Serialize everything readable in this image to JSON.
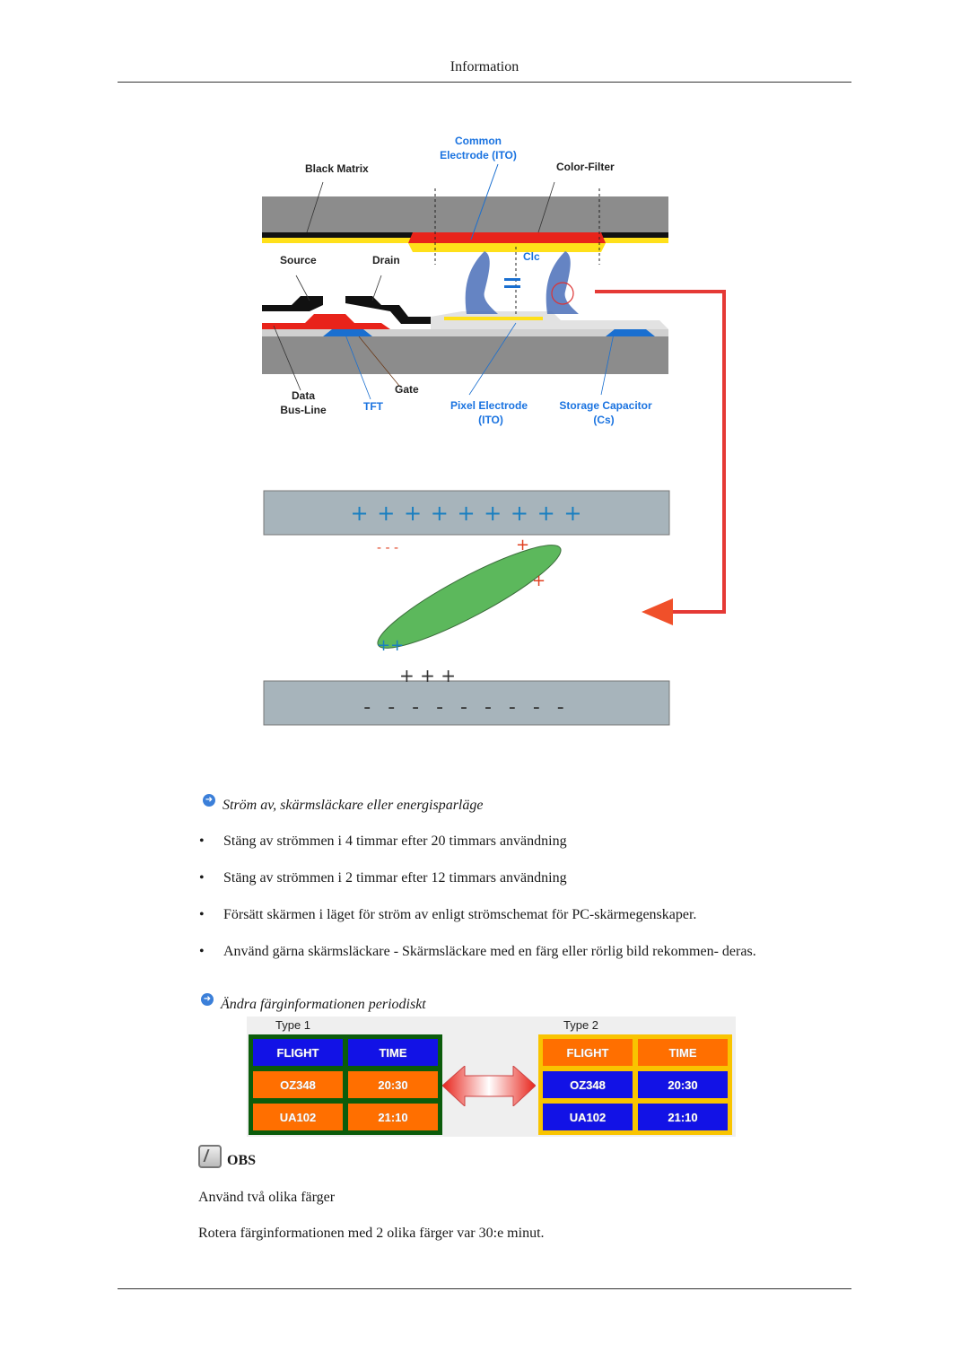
{
  "header": {
    "title": "Information"
  },
  "figure_lcd": {
    "labels": {
      "black_matrix": "Black Matrix",
      "common_electrode": [
        "Common",
        "Electrode (ITO)"
      ],
      "color_filter": "Color-Filter",
      "source": "Source",
      "drain": "Drain",
      "clc": "Clc",
      "data_bus_line": [
        "Data",
        "Bus-Line"
      ],
      "tft": "TFT",
      "gate": "Gate",
      "pixel_electrode": [
        "Pixel Electrode",
        "(ITO)"
      ],
      "storage_capacitor": [
        "Storage Capacitor",
        "(Cs)"
      ]
    },
    "top_plate_charges": "+ + + + + + + + +",
    "bottom_plate_charges": "- - - - - - - - -",
    "colors": {
      "glass": "#8c8c8c",
      "black_matrix": "#111111",
      "color_filter": "#e8231a",
      "ito": "#ffe01a",
      "gate": "#1a6fd0",
      "crystal": "#5cb85c",
      "plate": "#a7b4bb",
      "arrow": "#e53935"
    }
  },
  "section1": {
    "icon": "arrow-right-circle-icon",
    "title": "Ström av, skärmsläckare eller energisparläge",
    "bullets": [
      "Stäng av strömmen i 4 timmar efter 20 timmars användning",
      "Stäng av strömmen i 2 timmar efter 12 timmars användning",
      "Försätt skärmen i läget för ström av enligt strömschemat för PC-skärmegenskaper.",
      "Använd gärna skärmsläckare - Skärmsläckare med en färg eller rörlig bild rekommen- deras."
    ]
  },
  "section2": {
    "icon": "arrow-right-circle-icon",
    "title": "Ändra färginformationen periodiskt",
    "type1": {
      "label": "Type 1",
      "border_color": "#0b5c0b",
      "rows": [
        [
          "FLIGHT",
          "TIME"
        ],
        [
          "OZ348",
          "20:30"
        ],
        [
          "UA102",
          "21:10"
        ]
      ]
    },
    "type2": {
      "label": "Type 2",
      "border_color": "#f9c400",
      "rows": [
        [
          "FLIGHT",
          "TIME"
        ],
        [
          "OZ348",
          "20:30"
        ],
        [
          "UA102",
          "21:10"
        ]
      ]
    }
  },
  "note": {
    "icon": "note-pencil-icon",
    "label": "OBS",
    "lines": [
      "Använd två olika färger",
      "Rotera färginformationen med 2 olika färger var 30:e minut."
    ]
  }
}
